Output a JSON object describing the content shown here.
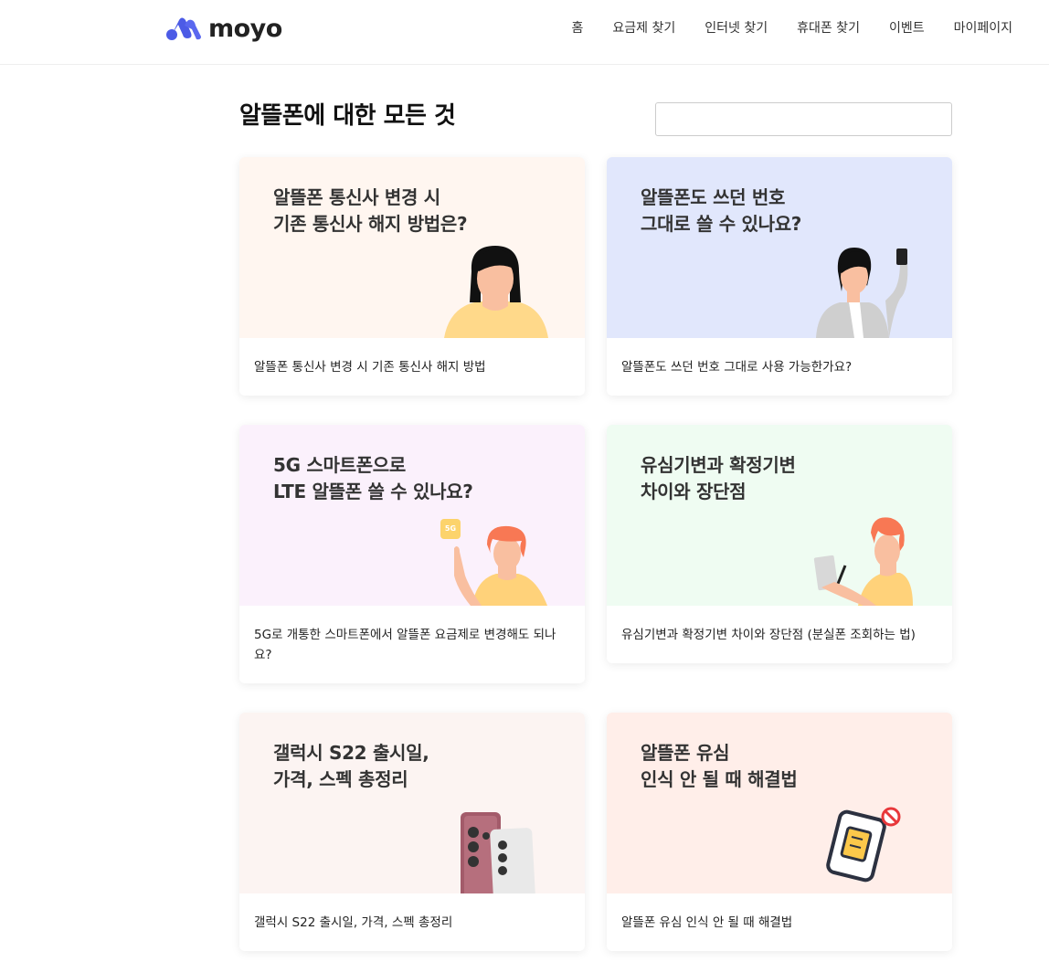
{
  "brand": {
    "name": "moyo"
  },
  "nav": {
    "items": [
      "홈",
      "요금제 찾기",
      "인터넷 찾기",
      "휴대폰 찾기",
      "이벤트",
      "마이페이지"
    ]
  },
  "page": {
    "title": "알뜰폰에 대한 모든 것"
  },
  "search": {
    "placeholder": "",
    "value": ""
  },
  "cards": [
    {
      "headline": "알뜰폰 통신사 변경 시\n기존 통신사 해지 방법은?",
      "caption": "알뜰폰 통신사 변경 시 기존 통신사 해지 방법",
      "bg": "#fff6f0"
    },
    {
      "headline": "알뜰폰도 쓰던 번호\n그대로 쓸 수 있나요?",
      "caption": "알뜰폰도 쓰던 번호 그대로 사용 가능한가요?",
      "bg": "#e1e7fc"
    },
    {
      "headline": "5G 스마트폰으로\nLTE 알뜰폰 쓸 수 있나요?",
      "caption": "5G로 개통한 스마트폰에서 알뜰폰 요금제로 변경해도 되나요?",
      "bg": "#fbf1fc",
      "badge": "5G"
    },
    {
      "headline": "유심기변과 확정기변\n차이와 장단점",
      "caption": "유심기변과 확정기변 차이와 장단점 (분실폰 조회하는 법)",
      "bg": "#effcf2"
    },
    {
      "headline": "갤럭시 S22 출시일,\n가격, 스펙 총정리",
      "caption": "갤럭시 S22 출시일, 가격, 스펙 총정리",
      "bg": "#fcf4f2"
    },
    {
      "headline": "알뜰폰 유심\n인식 안 될 때 해결법",
      "caption": "알뜰폰 유심 인식 안 될 때 해결법",
      "bg": "#ffeee9"
    }
  ]
}
